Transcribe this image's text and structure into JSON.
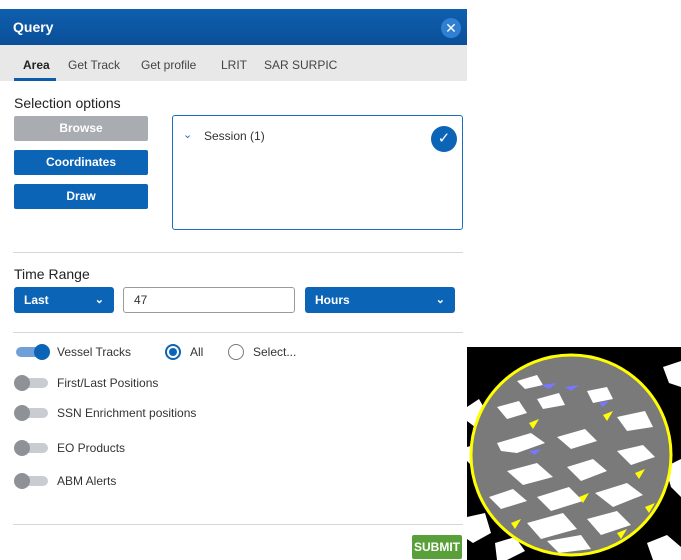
{
  "titlebar": {
    "title": "Query",
    "close_glyph": "✕"
  },
  "tabs": [
    "Area",
    "Get Track",
    "Get profile",
    "LRIT",
    "SAR SURPIC"
  ],
  "selection": {
    "heading": "Selection options",
    "browse_label": "Browse",
    "coordinates_label": "Coordinates",
    "draw_label": "Draw",
    "session_label": "Session (1)",
    "check_glyph": "✓",
    "chevron_glyph": "⌄"
  },
  "time_range": {
    "heading": "Time Range",
    "mode_value": "Last",
    "amount_value": "47",
    "unit_value": "Hours",
    "chevron_glyph": "⌄"
  },
  "layers": {
    "vessel_tracks": {
      "label": "Vessel Tracks",
      "on": true
    },
    "radio_all_label": "All",
    "radio_select_label": "Select...",
    "first_last": {
      "label": "First/Last Positions",
      "on": false
    },
    "ssn": {
      "label": "SSN Enrichment positions",
      "on": false
    },
    "eo": {
      "label": "EO Products",
      "on": false
    },
    "abm": {
      "label": "ABM Alerts",
      "on": false
    }
  },
  "submit_label": "SUBMIT",
  "colors": {
    "primary": "#0c64b7",
    "titlebar": "#0a4f98",
    "submit": "#5aa03a",
    "map_circle": "#ffff00",
    "map_sea": "#7a7a7a"
  }
}
